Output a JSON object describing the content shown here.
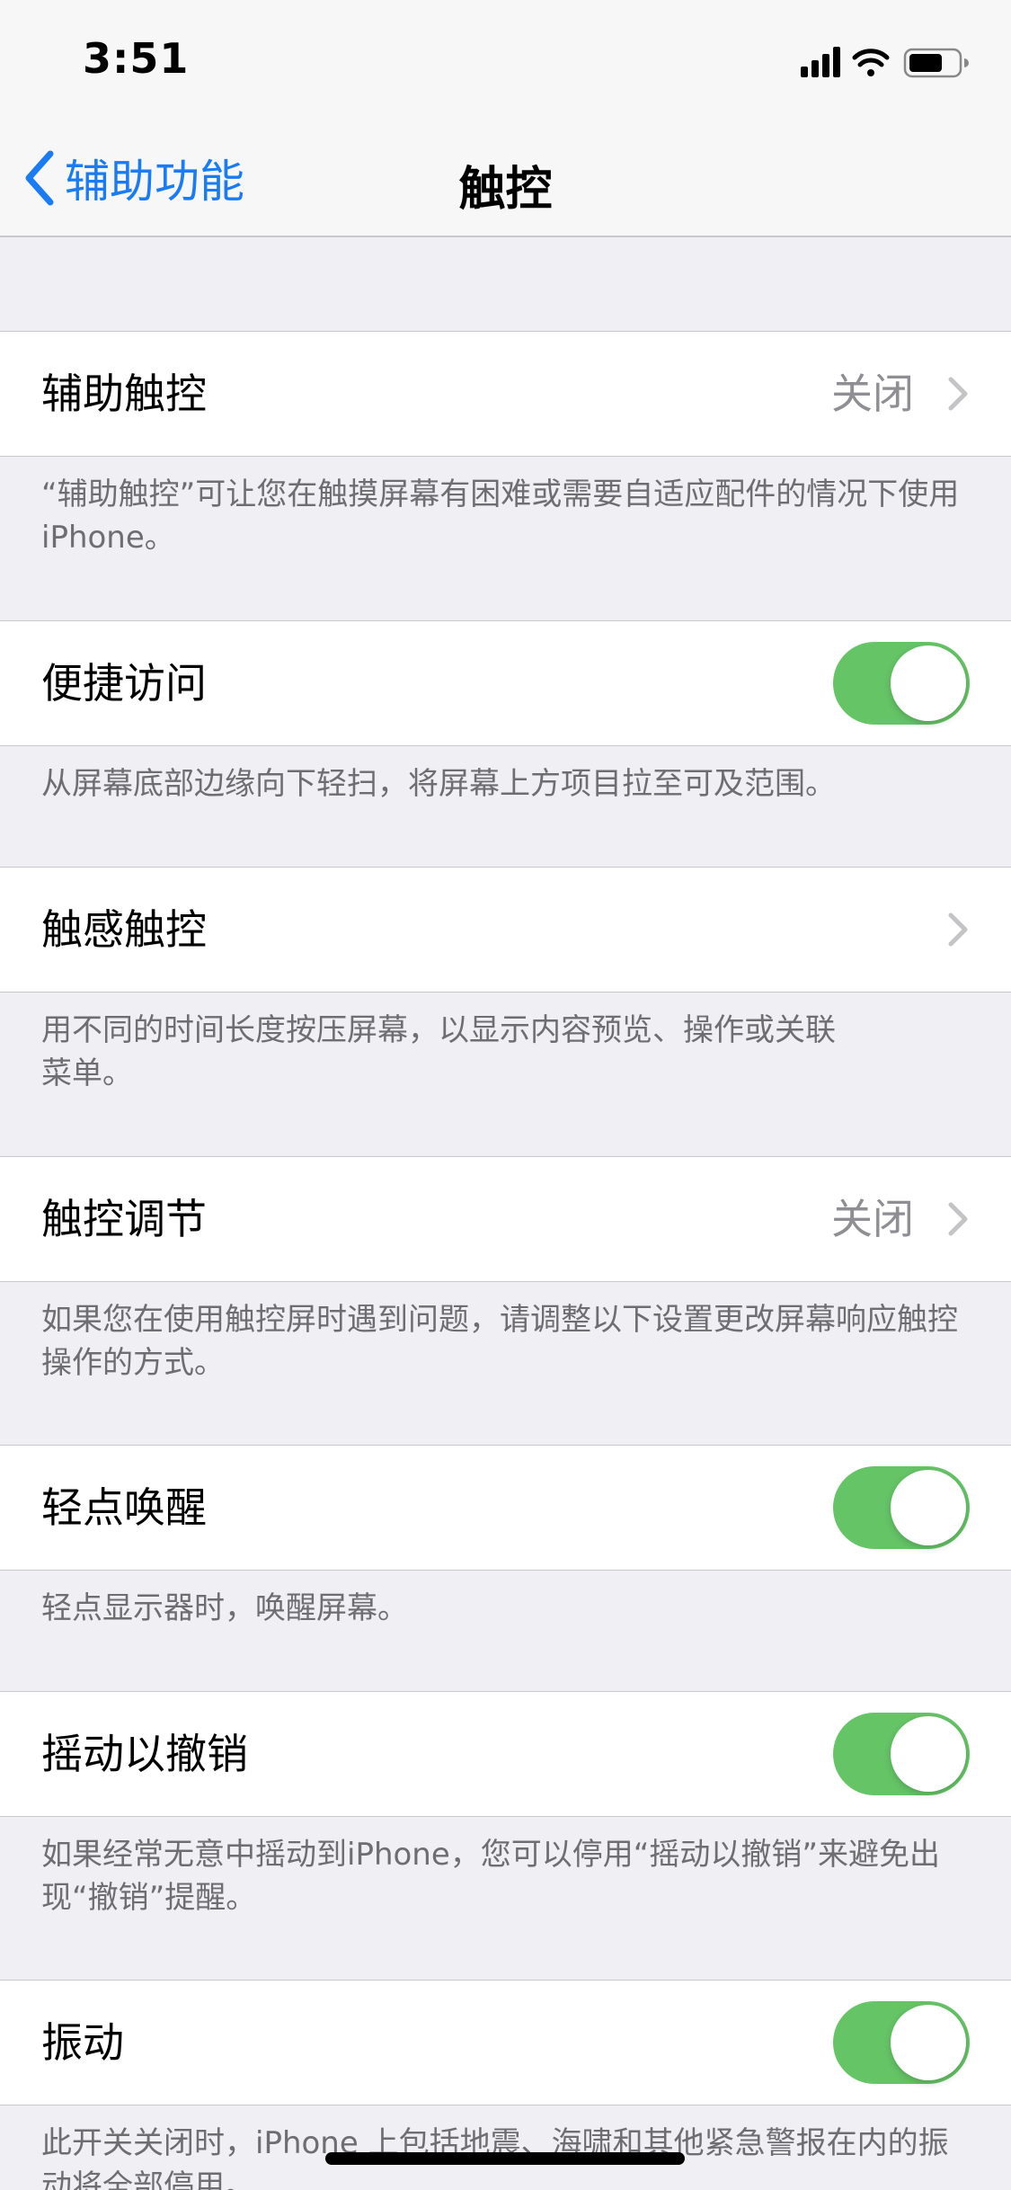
{
  "status_bar": {
    "time": "3:51",
    "signal_icon": "cellular-signal-icon",
    "wifi_icon": "wifi-icon",
    "battery_icon": "battery-icon",
    "battery_level": 0.7
  },
  "nav": {
    "back_label": "辅助功能",
    "back_icon": "chevron-left-icon",
    "title": "触控"
  },
  "colors": {
    "accent": "#1a7cf4",
    "toggle_on": "#65c466",
    "background": "#efeff4"
  },
  "settings": [
    {
      "label": "辅助触控",
      "value": "关闭",
      "control": "disclosure",
      "footer": "“辅助触控”可让您在触摸屏幕有困难或需要自适应配件的情况下使用 iPhone。"
    },
    {
      "label": "便捷访问",
      "control": "toggle",
      "on": true,
      "footer": "从屏幕底部边缘向下轻扫，将屏幕上方项目拉至可及范围。"
    },
    {
      "label": "触感触控",
      "control": "disclosure",
      "footer": "用不同的时间长度按压屏幕，以显示内容预览、操作或关联菜单。"
    },
    {
      "label": "触控调节",
      "value": "关闭",
      "control": "disclosure",
      "footer": "如果您在使用触控屏时遇到问题，请调整以下设置更改屏幕响应触控操作的方式。"
    },
    {
      "label": "轻点唤醒",
      "control": "toggle",
      "on": true,
      "footer": "轻点显示器时，唤醒屏幕。"
    },
    {
      "label": "摇动以撤销",
      "control": "toggle",
      "on": true,
      "footer": "如果经常无意中摇动到iPhone，您可以停用“摇动以撤销”来避免出现“撤销”提醒。"
    },
    {
      "label": "振动",
      "control": "toggle",
      "on": true,
      "footer": "此开关关闭时，iPhone 上包括地震、海啸和其他紧急警报在内的振动将全部停用。"
    }
  ]
}
